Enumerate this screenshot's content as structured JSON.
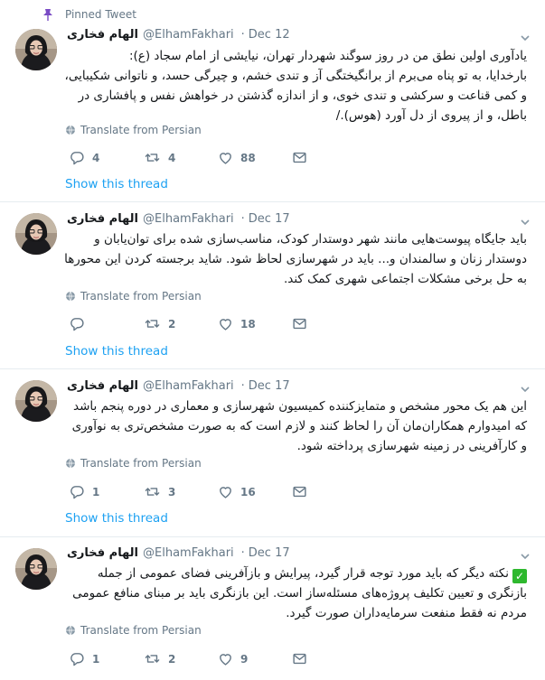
{
  "pinned_label": "Pinned Tweet",
  "tweets": [
    {
      "name": "الهام فخاری",
      "handle": "@ElhamFakhari",
      "date": "Dec 12",
      "lines": [
        "یادآوری اولین نطق من در روز سوگند شهردار تهران، نیایشی از امام سجاد (ع):",
        "بارخدایا، به تو پناه می‌برم از برانگیختگی آز و تندی خشم، و چیرگی حسد، و ناتوانی شکیبایی،",
        "و کمی قناعت و سرکشی و تندی خوی، و از اندازه گذشتن در خواهش نفس و پافشاری در",
        "باطل، و از پیروی از دل آورد (هوس)./"
      ],
      "translate": "Translate from Persian",
      "replies": "4",
      "retweets": "4",
      "likes": "88",
      "show_thread": "Show this thread"
    },
    {
      "name": "الهام فخاری",
      "handle": "@ElhamFakhari",
      "date": "Dec 17",
      "lines": [
        "باید جایگاه پیوست‌هایی مانند شهر دوستدار کودک، مناسب‌سازی شده برای توان‌یابان  و",
        "دوستدار زنان و سالمندان و... باید در شهرسازی لحاظ شود. شاید برجسته کردن این محورها",
        "به حل برخی مشکلات اجتماعی شهری کمک کند."
      ],
      "translate": "Translate from Persian",
      "replies": "",
      "retweets": "2",
      "likes": "18",
      "show_thread": "Show this thread"
    },
    {
      "name": "الهام فخاری",
      "handle": "@ElhamFakhari",
      "date": "Dec 17",
      "lines": [
        "این هم یک محور مشخص و متمایزکننده کمیسیون شهرسازی و معماری در دوره پنجم باشد",
        "که امیدوارم همکاران‌مان آن را لحاظ کنند و لازم است که به صورت مشخص‌تری به نوآوری",
        "و کارآفرینی در زمینه شهرسازی پرداخته شود."
      ],
      "translate": "Translate from Persian",
      "replies": "1",
      "retweets": "3",
      "likes": "16",
      "show_thread": "Show this thread"
    },
    {
      "name": "الهام فخاری",
      "handle": "@ElhamFakhari",
      "date": "Dec 17",
      "lines": [
        "نکته دیگر که باید مورد توجه قرار گیرد، پیرایش و بازآفرینی فضای عمومی از جمله",
        "بازنگری و تعیین تکلیف پروژه‌های مسئله‌ساز است. این بازنگری باید بر مبنای منافع عمومی",
        "مردم نه فقط منفعت سرمایه‌داران صورت گیرد."
      ],
      "translate": "Translate from Persian",
      "replies": "1",
      "retweets": "2",
      "likes": "9"
    }
  ],
  "colors": {
    "link": "#1da1f2",
    "muted": "#657786",
    "text": "#14171a",
    "border": "#e6ecf0"
  },
  "icons": [
    "pin-icon",
    "avatar",
    "chevron-down-icon",
    "globe-icon",
    "reply-icon",
    "retweet-icon",
    "like-icon",
    "message-icon",
    "check-mark-icon"
  ]
}
